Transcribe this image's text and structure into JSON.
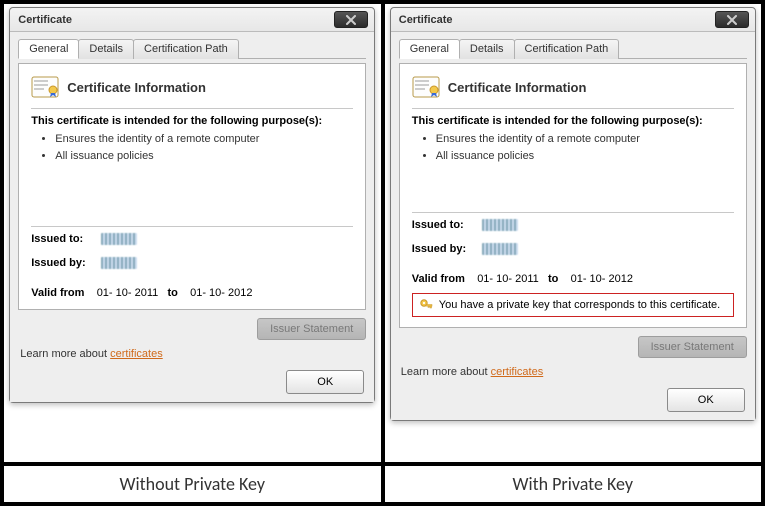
{
  "captions": {
    "left": "Without Private Key",
    "right": "With Private Key"
  },
  "dialog": {
    "title": "Certificate",
    "tabs": [
      "General",
      "Details",
      "Certification Path"
    ],
    "header_title": "Certificate Information",
    "purpose_heading": "This certificate is intended for the following purpose(s):",
    "purposes": [
      "Ensures the identity of a remote computer",
      "All issuance policies"
    ],
    "issued_to_label": "Issued to:",
    "issued_by_label": "Issued by:",
    "valid_from_label": "Valid from",
    "valid_from": "01- 10- 2011",
    "valid_to_label": "to",
    "valid_to": "01- 10- 2012",
    "private_key_text": "You have a private key that corresponds to this certificate.",
    "issuer_statement_label": "Issuer Statement",
    "learn_more_prefix": "Learn more about ",
    "learn_more_link": "certificates",
    "ok_label": "OK"
  }
}
